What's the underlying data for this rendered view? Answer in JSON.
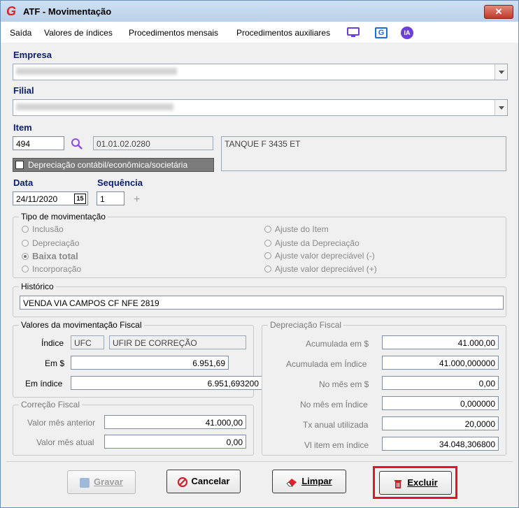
{
  "window": {
    "title": "ATF - Movimentação",
    "close_label": "✕"
  },
  "menu": {
    "items": [
      "Saída",
      "Valores de índices",
      "Procedimentos mensais",
      "Procedimentos auxiliares"
    ],
    "icon_names": [
      "monitor-icon",
      "g-logo-icon",
      "ia-icon"
    ],
    "ia_label": "IA",
    "g_label": "G"
  },
  "empresa": {
    "label": "Empresa",
    "value": ""
  },
  "filial": {
    "label": "Filial",
    "value": ""
  },
  "item": {
    "label": "Item",
    "code": "494",
    "account": "01.01.02.0280",
    "description": "TANQUE F 3435 ET",
    "checkbox_label": "Depreciação contábil/econômica/societária"
  },
  "data": {
    "label": "Data",
    "value": "24/11/2020",
    "calendar_label": "15"
  },
  "sequencia": {
    "label": "Sequência",
    "value": "1"
  },
  "tipo": {
    "title": "Tipo de movimentação",
    "left": [
      "Inclusão",
      "Depreciação",
      "Baixa total",
      "Incorporação"
    ],
    "right": [
      "Ajuste do Item",
      "Ajuste da Depreciação",
      "Ajuste valor depreciável (-)",
      "Ajuste valor depreciável (+)"
    ],
    "selected": "Baixa total"
  },
  "historico": {
    "title": "Histórico",
    "value": "VENDA VIA CAMPOS CF NFE 2819"
  },
  "valores": {
    "title": "Valores da movimentação Fiscal",
    "indice_label": "Índice",
    "indice_code": "UFC",
    "indice_name": "UFIR DE CORREÇÃO",
    "em_label": "Em $",
    "em_value": "6.951,69",
    "em_indice_label": "Em índice",
    "em_indice_value": "6.951,693200"
  },
  "correcao": {
    "title": "Correção Fiscal",
    "anterior_label": "Valor mês anterior",
    "anterior_value": "41.000,00",
    "atual_label": "Valor mês atual",
    "atual_value": "0,00"
  },
  "depreciacao": {
    "title": "Depreciação Fiscal",
    "rows": [
      {
        "label": "Acumulada em $",
        "value": "41.000,00"
      },
      {
        "label": "Acumulada em Índice",
        "value": "41.000,000000"
      },
      {
        "label": "No mês em $",
        "value": "0,00"
      },
      {
        "label": "No mês em Índice",
        "value": "0,000000"
      },
      {
        "label": "Tx anual utilizada",
        "value": "20,0000"
      },
      {
        "label": "Vl item em índice",
        "value": "34.048,306800"
      }
    ]
  },
  "buttons": {
    "gravar": "Gravar",
    "cancelar": "Cancelar",
    "limpar": "Limpar",
    "excluir": "Excluir"
  },
  "colors": {
    "title_accent": "#d22222",
    "label_blue": "#0b1e6b",
    "highlight_red": "#e8141c",
    "icon_purple": "#6b3fd8"
  }
}
